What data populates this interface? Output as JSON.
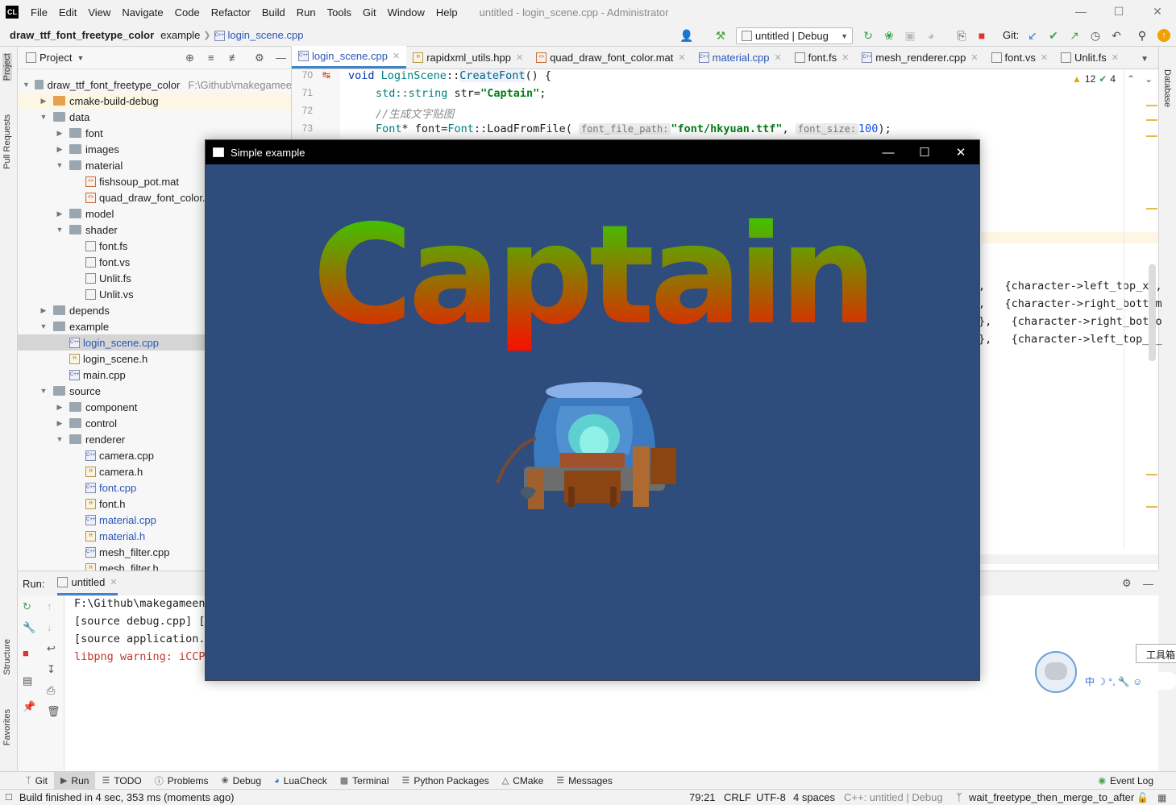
{
  "menubar": {
    "logo": "CL",
    "items": [
      "File",
      "Edit",
      "View",
      "Navigate",
      "Code",
      "Refactor",
      "Build",
      "Run",
      "Tools",
      "Git",
      "Window",
      "Help"
    ],
    "title": "untitled - login_scene.cpp - Administrator"
  },
  "nav": {
    "project": "draw_ttf_font_freetype_color",
    "folder": "example",
    "file": "login_scene.cpp",
    "run_config": "untitled | Debug",
    "git_label": "Git:"
  },
  "left_strip": {
    "project": "Project",
    "pull_requests": "Pull Requests",
    "structure": "Structure",
    "favorites": "Favorites"
  },
  "right_strip": {
    "database": "Database"
  },
  "project_panel": {
    "title": "Project",
    "tree": [
      {
        "label": "draw_ttf_font_freetype_color",
        "path": "F:\\Github\\makegamee",
        "type": "folder"
      },
      {
        "label": "cmake-build-debug",
        "type": "folder-orange"
      },
      {
        "label": "data",
        "type": "folder"
      },
      {
        "label": "font",
        "type": "folder"
      },
      {
        "label": "images",
        "type": "folder"
      },
      {
        "label": "material",
        "type": "folder"
      },
      {
        "label": "fishsoup_pot.mat",
        "type": "mat"
      },
      {
        "label": "quad_draw_font_color.m",
        "type": "mat"
      },
      {
        "label": "model",
        "type": "folder"
      },
      {
        "label": "shader",
        "type": "folder"
      },
      {
        "label": "font.fs",
        "type": "sh"
      },
      {
        "label": "font.vs",
        "type": "sh"
      },
      {
        "label": "Unlit.fs",
        "type": "sh"
      },
      {
        "label": "Unlit.vs",
        "type": "sh"
      },
      {
        "label": "depends",
        "type": "folder"
      },
      {
        "label": "example",
        "type": "folder"
      },
      {
        "label": "login_scene.cpp",
        "type": "cpp"
      },
      {
        "label": "login_scene.h",
        "type": "h"
      },
      {
        "label": "main.cpp",
        "type": "cpp"
      },
      {
        "label": "source",
        "type": "folder"
      },
      {
        "label": "component",
        "type": "folder"
      },
      {
        "label": "control",
        "type": "folder"
      },
      {
        "label": "renderer",
        "type": "folder"
      },
      {
        "label": "camera.cpp",
        "type": "cpp"
      },
      {
        "label": "camera.h",
        "type": "h"
      },
      {
        "label": "font.cpp",
        "type": "cpp"
      },
      {
        "label": "font.h",
        "type": "h"
      },
      {
        "label": "material.cpp",
        "type": "cpp"
      },
      {
        "label": "material.h",
        "type": "h"
      },
      {
        "label": "mesh_filter.cpp",
        "type": "cpp"
      },
      {
        "label": "mesh_filter.h",
        "type": "h"
      }
    ]
  },
  "editor": {
    "tabs": [
      "login_scene.cpp",
      "rapidxml_utils.hpp",
      "quad_draw_font_color.mat",
      "material.cpp",
      "font.fs",
      "mesh_renderer.cpp",
      "font.vs",
      "Unlit.fs"
    ],
    "inspection": {
      "warnings": "12",
      "weak": "4"
    },
    "line_numbers": [
      "70",
      "71",
      "72",
      "73"
    ],
    "code": {
      "l70_void": "void",
      "l70_cls": "LoginScene",
      "l70_sep": "::",
      "l70_fn": "CreateFont",
      "l70_rest": "() {",
      "l71_ns": "std",
      "l71_type": "::string",
      "l71_var": " str=",
      "l71_str": "\"Captain\"",
      "l71_end": ";",
      "l72_comment": "//生成文字贴图",
      "l73_a": "Font",
      "l73_b": "* font=",
      "l73_c": "Font",
      "l73_d": "::LoadFromFile( ",
      "l73_hint1": "font_file_path:",
      "l73_str": "\"font/hkyuan.ttf\"",
      "l73_e": ", ",
      "l73_hint2": "font_size:",
      "l73_num": "100",
      "l73_f": ");"
    },
    "partial_lines": [
      {
        "pre": ",",
        "text": "{character->left_top_x_,"
      },
      {
        "pre": ",",
        "text": "{character->right_bottom"
      },
      {
        "pre": "},",
        "text": "{character->right_botto"
      },
      {
        "pre": "},",
        "text": "{character->left_top_x_"
      }
    ]
  },
  "run_panel": {
    "label": "Run:",
    "tab": "untitled",
    "lines": [
      "F:\\Github\\makegameeng",
      "[source debug.cpp] [-",
      "[source application.c",
      "libpng warning: iCCP"
    ]
  },
  "sample_window": {
    "title": "Simple example",
    "rendered_text": "Captain"
  },
  "ime": {
    "toolbox": "工具箱",
    "chars": "中 ☽ °, 🔧 ☺"
  },
  "bottom_tools": [
    "Git",
    "Run",
    "TODO",
    "Problems",
    "Debug",
    "LuaCheck",
    "Terminal",
    "Python Packages",
    "CMake",
    "Messages",
    "Event Log"
  ],
  "status": {
    "message": "Build finished in 4 sec, 353 ms (moments ago)",
    "position": "79:21",
    "line_sep": "CRLF",
    "encoding": "UTF-8",
    "indent": "4 spaces",
    "context": "C++: untitled | Debug",
    "branch": "wait_freetype_then_merge_to_after"
  },
  "colors": {
    "accent": "#4083c9",
    "sample_bg": "#2e4c7c",
    "text_top": "#22e000",
    "text_bottom": "#ff0a00"
  }
}
